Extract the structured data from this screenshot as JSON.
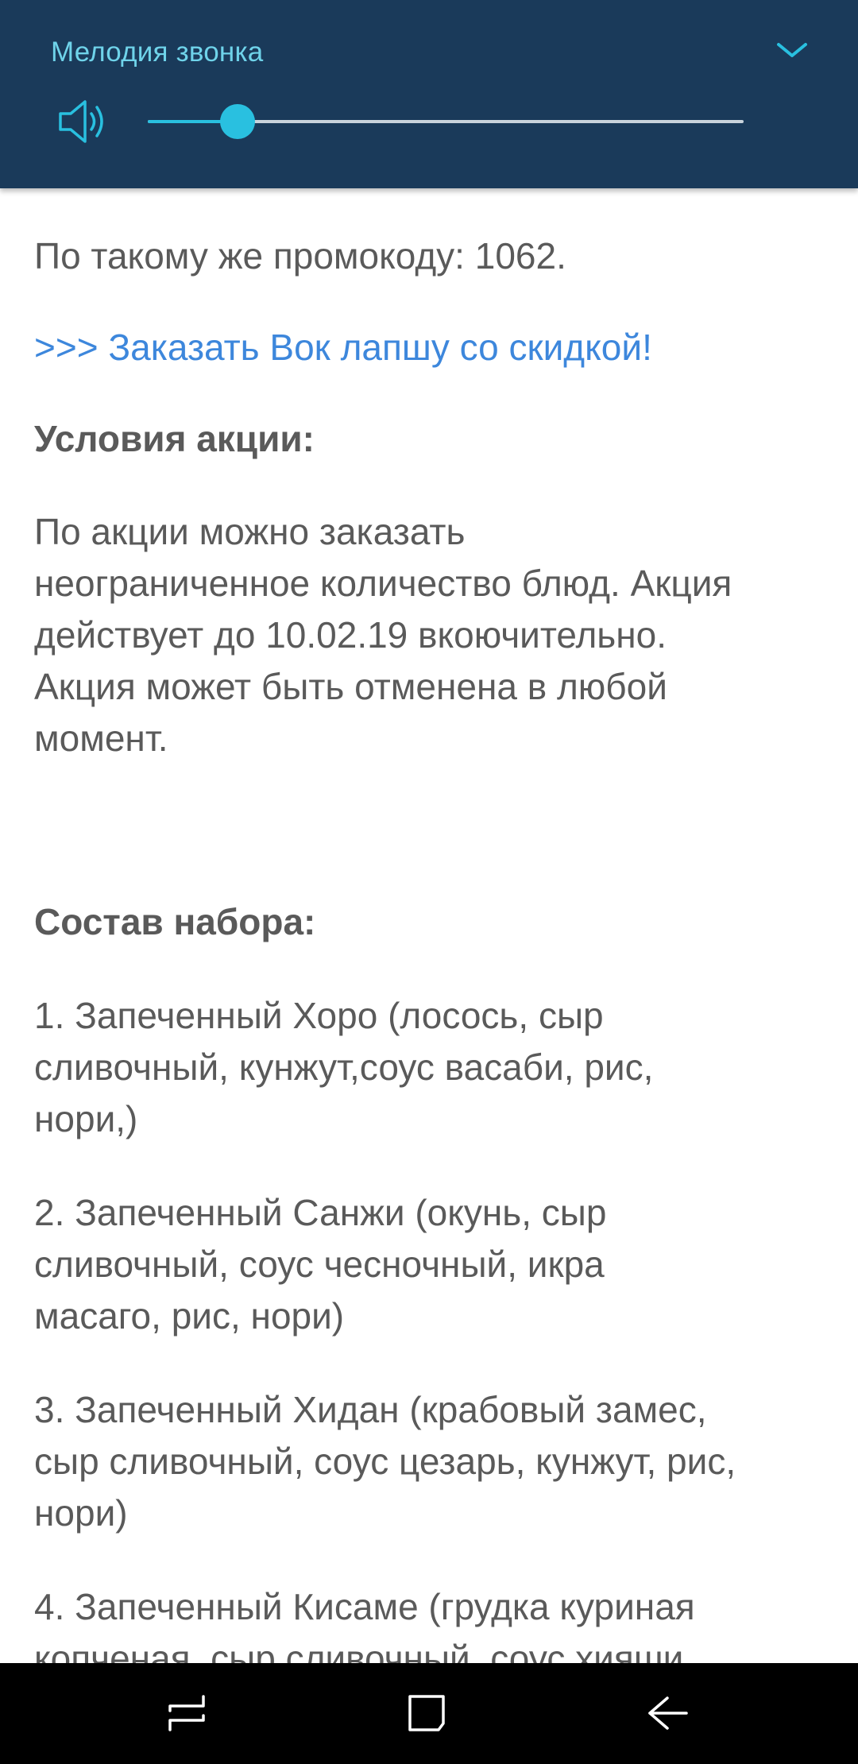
{
  "volume_panel": {
    "title": "Мелодия звонка",
    "level_percent": 15,
    "accent_color": "#29c0e0",
    "background_color": "#1a3a5a",
    "icons": {
      "speaker": "speaker-volume-icon",
      "expand": "chevron-down-icon"
    }
  },
  "content": {
    "promo_text": "По такому же промокоду: 1062.",
    "order_link": ">>> Заказать Вок лапшу со скидкой!",
    "link_color": "#3d87dc",
    "conditions_heading": "Условия акции:",
    "conditions_lines": [
      "По акции можно заказать",
      "неограниченное количество блюд. Акция",
      "действует до 10.02.19 вкоючительно.",
      "Акция может быть отменена в любой",
      "момент."
    ],
    "composition_heading": "Состав набора:",
    "set_items": [
      {
        "lines": [
          "1. Запеченный Хоро (лосось, сыр",
          "сливочный, кунжут,соус васаби, рис,",
          "нори,)"
        ]
      },
      {
        "lines": [
          "2. Запеченный Санжи (окунь, сыр",
          "сливочный, соус чесночный, икра",
          "масаго, рис, нори)"
        ]
      },
      {
        "lines": [
          "3. Запеченный Хидан (крабовый замес,",
          "сыр сливочный, соус цезарь, кунжут, рис,",
          "нори)"
        ]
      },
      {
        "lines": [
          "4. Запеченный Кисаме (грудка куриная",
          "копченая, сыр сливочный, соус хияши"
        ]
      }
    ]
  },
  "nav_bar": {
    "buttons": [
      {
        "name": "recents",
        "icon": "recents-icon"
      },
      {
        "name": "home",
        "icon": "home-icon"
      },
      {
        "name": "back",
        "icon": "back-arrow-icon"
      }
    ]
  }
}
